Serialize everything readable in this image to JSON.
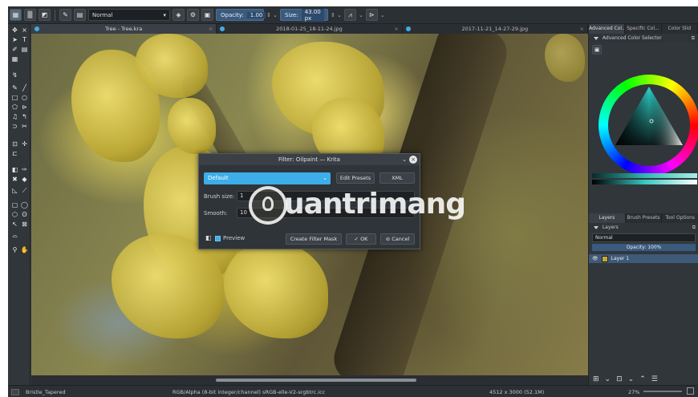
{
  "toolbar": {
    "blend_mode": "Normal",
    "opacity_label": "Opacity:",
    "opacity_value": "1.00",
    "size_label": "Size:",
    "size_value": "43.00 px"
  },
  "doc_tabs": [
    {
      "label": "Tree - Tree.kra"
    },
    {
      "label": "2018-01-25_18-11-24.jpg"
    },
    {
      "label": "2017-11-21_14-27-29.jpg"
    }
  ],
  "right_panel": {
    "tabs": [
      "Advanced Col...",
      "Specific Col...",
      "Color Slid"
    ],
    "color_selector_title": "Advanced Color Selector",
    "layers_tabs": [
      "Layers",
      "Brush Presets",
      "Tool Options"
    ],
    "layers_title": "Layers",
    "blend_mode": "Normal",
    "opacity": "Opacity: 100%",
    "layer_name": "Layer 1"
  },
  "dialog": {
    "title": "Filter: Oilpaint — Krita",
    "preset": "Default",
    "edit_presets": "Edit Presets",
    "xml": "XML",
    "brush_size_label": "Brush size:",
    "brush_size_value": "1",
    "smooth_label": "Smooth:",
    "smooth_value": "10",
    "preview_label": "Preview",
    "create_filter_mask": "Create Filter Mask",
    "ok": "OK",
    "cancel": "Cancel"
  },
  "watermark": {
    "text": "uantrimang"
  },
  "status": {
    "brush": "Bristle_Tapered",
    "color_profile": "RGB/Alpha (8-bit integer/channel)  sRGB-elle-V2-srgbtrc.icc",
    "dimensions": "4512 x 3000 (52.1M)",
    "zoom": "27%"
  },
  "colors": {
    "accent": "#3daee9",
    "panel_bg": "#31363b"
  }
}
